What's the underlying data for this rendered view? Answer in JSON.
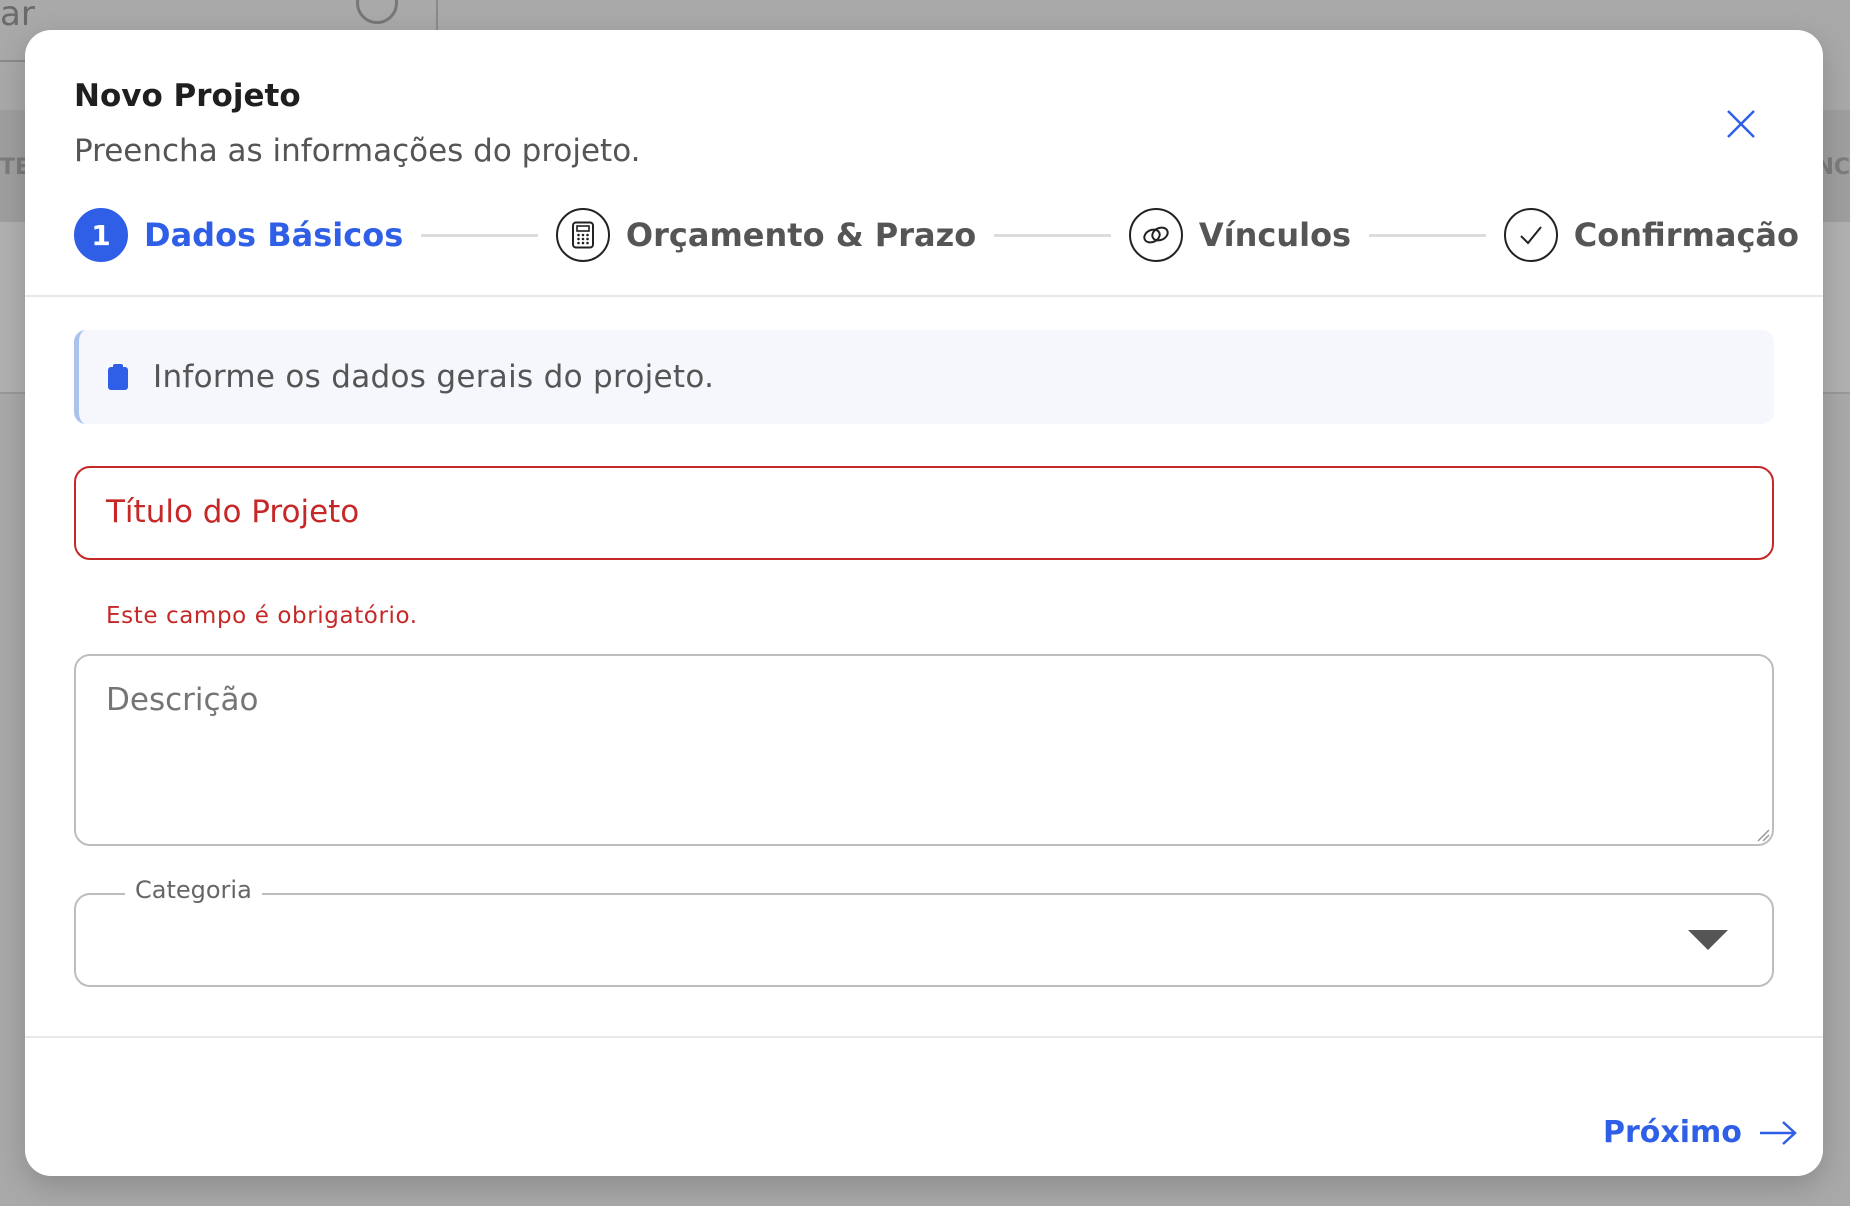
{
  "background": {
    "search_fragment": "ar",
    "left_header_fragment": "TE",
    "right_header_fragment": "NC"
  },
  "modal": {
    "title": "Novo Projeto",
    "subtitle": "Preencha as informações do projeto."
  },
  "stepper": {
    "active_index": 0,
    "steps": [
      {
        "number": "1",
        "label": "Dados Básicos",
        "icon": "number-badge"
      },
      {
        "label": "Orçamento & Prazo",
        "icon": "calculator-icon"
      },
      {
        "label": "Vínculos",
        "icon": "link-icon"
      },
      {
        "label": "Confirmação",
        "icon": "check-icon"
      }
    ]
  },
  "info": {
    "text": "Informe os dados gerais do projeto.",
    "icon": "clipboard-icon"
  },
  "form": {
    "title": {
      "placeholder": "Título do Projeto",
      "error": "Este campo é obrigatório."
    },
    "description": {
      "placeholder": "Descrição"
    },
    "category": {
      "label": "Categoria",
      "value": ""
    }
  },
  "footer": {
    "next_label": "Próximo"
  },
  "colors": {
    "accent": "#2f5fe6",
    "error": "#c62828",
    "info_bg": "#f5f7fc"
  }
}
